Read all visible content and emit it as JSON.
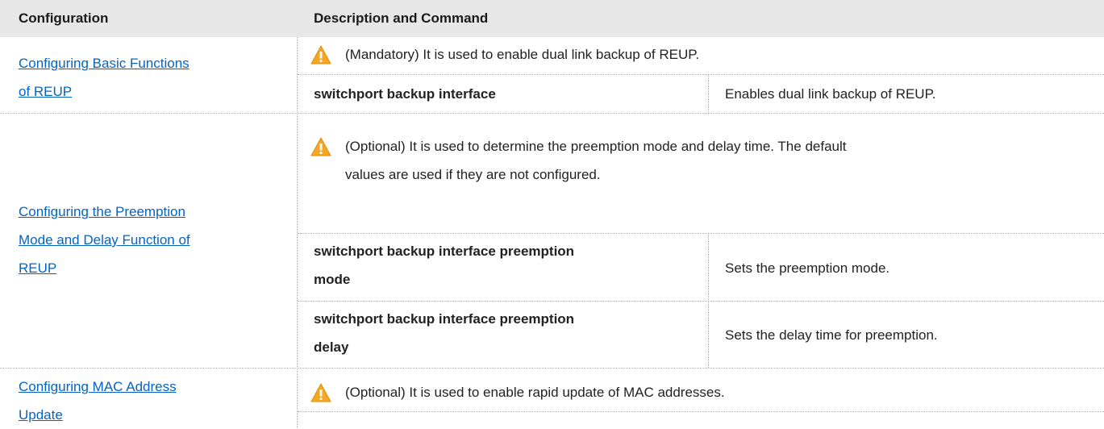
{
  "table": {
    "headers": [
      "Configuration",
      "Description and Command"
    ],
    "rows": [
      {
        "configuration": [
          "Configuring Basic Functions ",
          "of REUP"
        ],
        "note": [
          "(Mandatory) It is used to enable dual link backup of REUP."
        ],
        "commands": [
          {
            "command": [
              "switchport backup interface"
            ],
            "description": "Enables dual link backup of REUP."
          }
        ]
      },
      {
        "configuration": [
          "Configuring the Preemption ",
          "Mode and Delay Function of ",
          "REUP"
        ],
        "note": [
          "(Optional) It is used to determine the preemption mode and delay time. The default",
          "values are used if they are not configured."
        ],
        "commands": [
          {
            "command": [
              "switchport backup interface preemption",
              "mode"
            ],
            "description": "Sets the preemption mode."
          },
          {
            "command": [
              "switchport backup interface preemption",
              "delay"
            ],
            "description": "Sets the delay time for preemption."
          }
        ]
      },
      {
        "configuration": [
          "Configuring MAC Address ",
          "Update"
        ],
        "note": [
          "(Optional) It is used to enable rapid update of MAC addresses."
        ],
        "commands": []
      }
    ]
  },
  "icons": {
    "warning": "warning-triangle-icon",
    "warning_color": "#f5a623"
  },
  "colors": {
    "link": "#0563c1",
    "header_bg": "#e7e7e7"
  }
}
